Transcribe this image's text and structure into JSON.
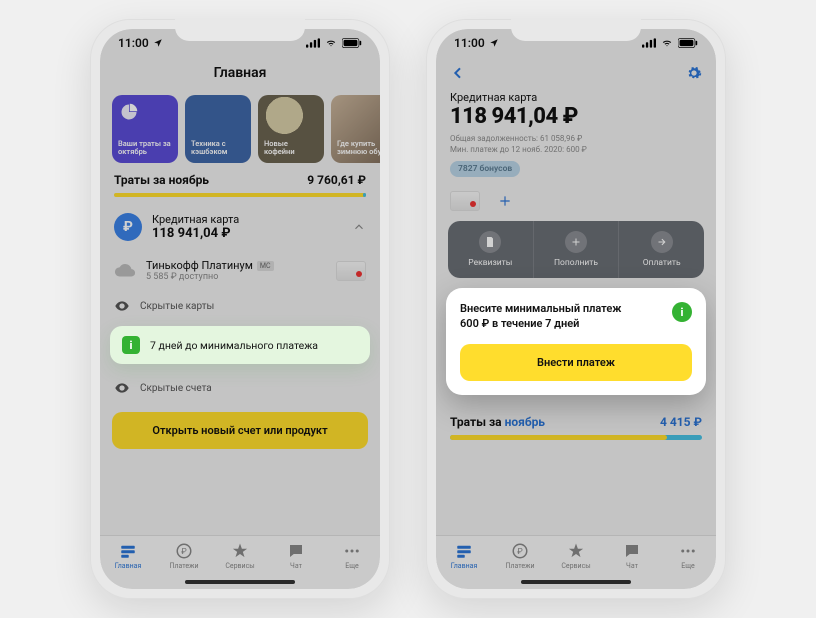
{
  "status": {
    "time": "11:00"
  },
  "phoneA": {
    "title": "Главная",
    "cards": [
      {
        "label": "Ваши траты за октябрь"
      },
      {
        "label": "Техника с кэшбэком"
      },
      {
        "label": "Новые кофейни"
      },
      {
        "label": "Где купить зимнюю обувь"
      }
    ],
    "spend": {
      "label": "Траты за ноябрь",
      "amount": "9 760,61 ₽"
    },
    "credit": {
      "label": "Кредитная карта",
      "amount": "118 941,04 ₽"
    },
    "platinum": {
      "name": "Тинькофф Платинум",
      "avail": "5 585 ₽ доступно"
    },
    "hiddenCards": "Скрытые карты",
    "notice": "7 дней до минимального платежа",
    "hiddenAccounts": "Скрытые счета",
    "cta": "Открыть новый счет или продукт"
  },
  "phoneB": {
    "label": "Кредитная карта",
    "amount": "118 941,04 ₽",
    "totalDebt": "Общая задолженность: 61 058,96 ₽",
    "minPay": "Мин. платеж до 12 нояб. 2020: 600 ₽",
    "bonus": "7827 бонусов",
    "actions": {
      "a": "Реквизиты",
      "b": "Пополнить",
      "c": "Оплатить"
    },
    "popup": {
      "line1": "Внесите минимальный платеж",
      "line2": "600 ₽ в течение 7 дней",
      "cta": "Внести платеж"
    },
    "spend": {
      "prefix": "Траты за ",
      "month": "ноябрь",
      "amount": "4 415 ₽"
    }
  },
  "tabs": {
    "a": "Главная",
    "b": "Платежи",
    "c": "Сервисы",
    "d": "Чат",
    "e": "Еще"
  }
}
